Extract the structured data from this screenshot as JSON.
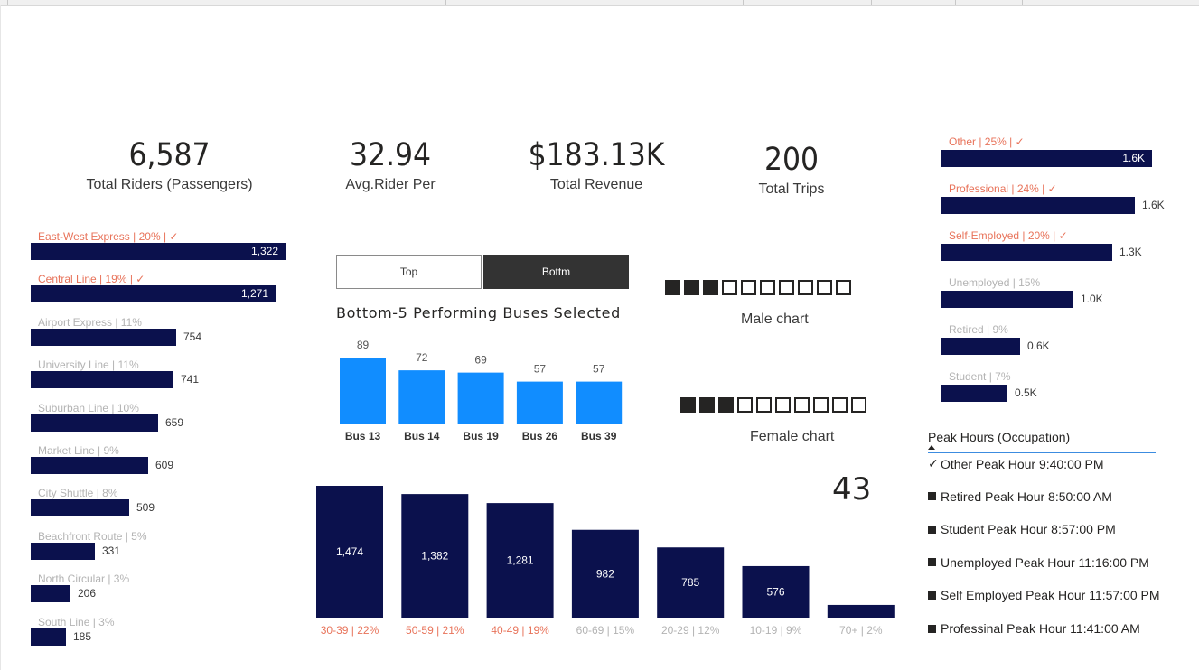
{
  "kpis": [
    {
      "value": "6,587",
      "label": "Total Riders (Passengers)"
    },
    {
      "value": "32.94",
      "label": "Avg.Rider Per"
    },
    {
      "value": "$183.13K",
      "label": "Total Revenue"
    },
    {
      "value": "200",
      "label": "Total Trips"
    }
  ],
  "routes": [
    {
      "label": "East-West Express | 20% | ✓",
      "value": "1,322",
      "selected": true
    },
    {
      "label": "Central Line | 19% | ✓",
      "value": "1,271",
      "selected": true
    },
    {
      "label": "Airport Express | 11%",
      "value": "754",
      "selected": false
    },
    {
      "label": "University Line | 11%",
      "value": "741",
      "selected": false
    },
    {
      "label": "Suburban Line | 10%",
      "value": "659",
      "selected": false
    },
    {
      "label": "Market Line | 9%",
      "value": "609",
      "selected": false
    },
    {
      "label": "City Shuttle | 8%",
      "value": "509",
      "selected": false
    },
    {
      "label": "Beachfront Route | 5%",
      "value": "331",
      "selected": false
    },
    {
      "label": "North Circular | 3%",
      "value": "206",
      "selected": false
    },
    {
      "label": "South Line | 3%",
      "value": "185",
      "selected": false
    }
  ],
  "toggle": {
    "top_label": "Top",
    "bottom_label": "Bottm",
    "active": "bottom"
  },
  "bus_chart": {
    "title": "Bottom-5 Performing Buses Selected"
  },
  "gender": {
    "male": {
      "label": "Male chart",
      "filled": 3,
      "total": 10
    },
    "female": {
      "label": "Female chart",
      "filled": 3,
      "total": 10
    }
  },
  "age_count": "43",
  "occupations": [
    {
      "label": "Other | 25% | ✓",
      "value": "1.6K",
      "selected": true
    },
    {
      "label": "Professional | 24% | ✓",
      "value": "1.6K",
      "selected": true
    },
    {
      "label": "Self-Employed | 20% | ✓",
      "value": "1.3K",
      "selected": true
    },
    {
      "label": "Unemployed | 15%",
      "value": "1.0K",
      "selected": false
    },
    {
      "label": "Retired | 9%",
      "value": "0.6K",
      "selected": false
    },
    {
      "label": "Student | 7%",
      "value": "0.5K",
      "selected": false
    }
  ],
  "peak_hours": {
    "title": "Peak Hours (Occupation)",
    "items": [
      {
        "text": "Other Peak Hour 9:40:00 PM",
        "checked": true
      },
      {
        "text": "Retired Peak Hour 8:50:00 AM",
        "checked": false
      },
      {
        "text": "Student Peak Hour 8:57:00 PM",
        "checked": false
      },
      {
        "text": "Unemployed Peak Hour 11:16:00 PM",
        "checked": false
      },
      {
        "text": "Self Employed Peak Hour 11:57:00 PM",
        "checked": false
      },
      {
        "text": "Professinal Peak Hour 11:41:00 AM",
        "checked": false
      }
    ]
  },
  "colors": {
    "navy": "#0b114d",
    "blue": "#118dff",
    "selected": "#e8735a",
    "dim": "#b3b3b3"
  },
  "chart_data": [
    {
      "type": "bar",
      "categories": [
        "Bus 13",
        "Bus 14",
        "Bus 19",
        "Bus 26",
        "Bus 39"
      ],
      "values": [
        89,
        72,
        69,
        57,
        57
      ],
      "title": "Bottom-5 Performing Buses Selected"
    },
    {
      "type": "bar",
      "categories": [
        "30-39 | 22%",
        "50-59 | 21%",
        "40-49 | 19%",
        "60-69 | 15%",
        "20-29 | 12%",
        "10-19 | 9%",
        "70+ | 2%"
      ],
      "values": [
        1474,
        1382,
        1281,
        982,
        785,
        576,
        142
      ],
      "value_labels": [
        "1,474",
        "1,382",
        "1,281",
        "982",
        "785",
        "576",
        ""
      ],
      "selected": [
        true,
        true,
        true,
        false,
        false,
        false,
        false
      ]
    },
    {
      "type": "bar",
      "categories": [
        "East-West Express",
        "Central Line",
        "Airport Express",
        "University Line",
        "Suburban Line",
        "Market Line",
        "City Shuttle",
        "Beachfront Route",
        "North Circular",
        "South Line"
      ],
      "values": [
        1322,
        1271,
        754,
        741,
        659,
        609,
        509,
        331,
        206,
        185
      ]
    },
    {
      "type": "bar",
      "categories": [
        "Other",
        "Professional",
        "Self-Employed",
        "Unemployed",
        "Retired",
        "Student"
      ],
      "values": [
        1600,
        1550,
        1300,
        1000,
        600,
        500
      ]
    }
  ]
}
